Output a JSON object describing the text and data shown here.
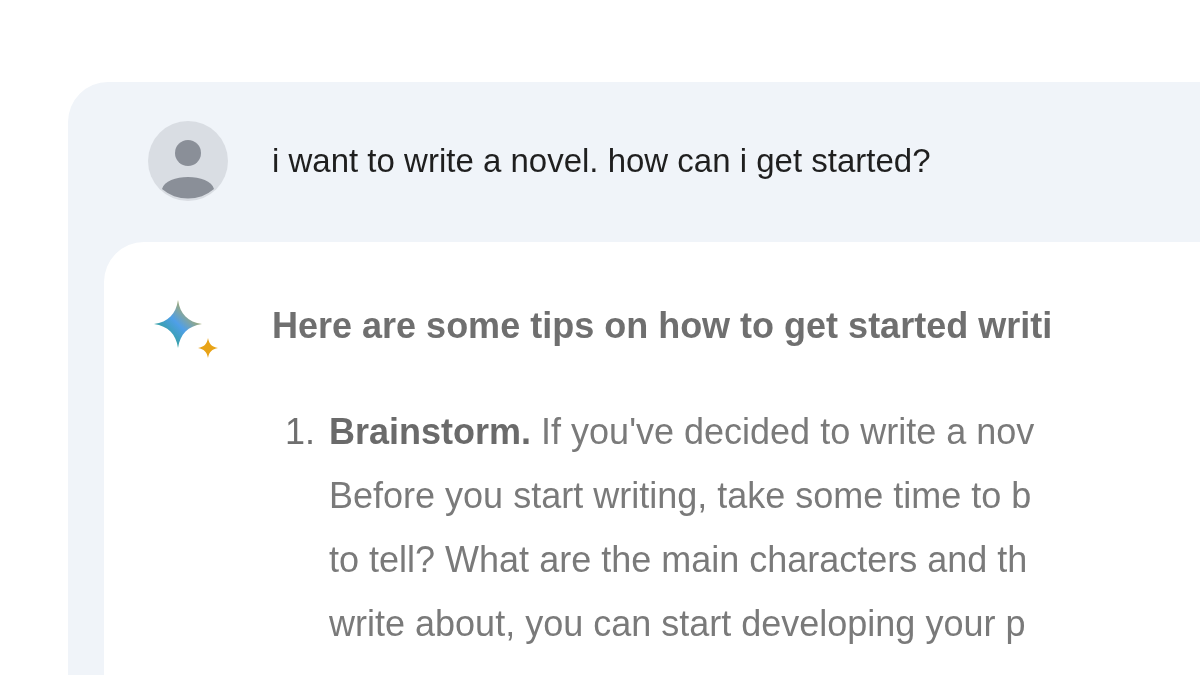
{
  "prompt": {
    "text": "i want to write a novel. how can i get started?"
  },
  "response": {
    "heading": "Here are some tips on how to get started writi",
    "items": [
      {
        "number": "1.",
        "lines": [
          "**Brainstorm.** If you've decided to write a nov",
          "Before you start writing, take some time to b",
          "to tell? What are the main characters and th",
          "write about, you can start developing your p"
        ]
      }
    ]
  }
}
